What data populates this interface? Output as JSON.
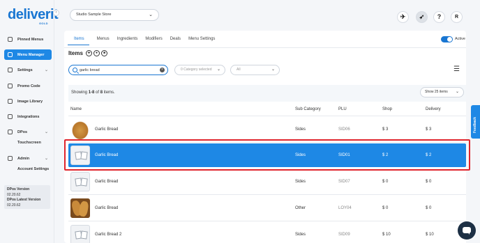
{
  "brand": {
    "name": "deliverit",
    "sub": "GOLD"
  },
  "sidebar": {
    "items": [
      {
        "label": "Pinned Menus"
      },
      {
        "label": "Menu Manager",
        "active": true
      },
      {
        "label": "Settings"
      },
      {
        "label": "Promo Code"
      },
      {
        "label": "Image Library"
      },
      {
        "label": "Integrations"
      },
      {
        "label": "DPos"
      },
      {
        "label": "Admin"
      }
    ],
    "sub_items": {
      "dpos": "Touchscreen",
      "admin": "Account Settings"
    },
    "version": {
      "label": "DPos Version",
      "value": "02.20.62",
      "latest_label": "DPos Latest Version",
      "latest_value": "02.20.62"
    }
  },
  "header": {
    "store": "Studio Sample Store",
    "avatar_initial": "R",
    "help": "?"
  },
  "tabs": [
    {
      "label": "Items",
      "active": true
    },
    {
      "label": "Menus"
    },
    {
      "label": "Ingredients"
    },
    {
      "label": "Modifiers"
    },
    {
      "label": "Deals"
    },
    {
      "label": "Menu Settings"
    }
  ],
  "active_toggle": {
    "label": "Active",
    "on": true
  },
  "items_section": {
    "title": "Items",
    "search_value": "garlic bread",
    "category_placeholder": "0 Category selected",
    "filter_all": "All",
    "showing_prefix": "Showing ",
    "showing_range": "1-8",
    "showing_of": " of ",
    "showing_total": "8",
    "showing_suffix": " items.",
    "page_size": "Show 25 items"
  },
  "table": {
    "headers": {
      "name": "Name",
      "sub_category": "Sub Category",
      "plu": "PLU",
      "shop": "Shop",
      "delivery": "Delivery"
    },
    "rows": [
      {
        "name": "Garlic Bread",
        "sub_category": "Sides",
        "plu": "SID06",
        "shop": "$ 3",
        "delivery": "$ 3",
        "thumb": "bread1"
      },
      {
        "name": "Garlic Bread",
        "sub_category": "Sides",
        "plu": "SID01",
        "shop": "$ 2",
        "delivery": "$ 2",
        "thumb": "placeholder",
        "selected": true
      },
      {
        "name": "Garlic Bread",
        "sub_category": "Sides",
        "plu": "SID07",
        "shop": "$ 0",
        "delivery": "$ 0",
        "thumb": "placeholder"
      },
      {
        "name": "Garlic Bread",
        "sub_category": "Other",
        "plu": "LOY04",
        "shop": "$ 0",
        "delivery": "$ 0",
        "thumb": "bread2"
      },
      {
        "name": "Garlic Bread 2",
        "sub_category": "Sides",
        "plu": "SID09",
        "shop": "$ 10",
        "delivery": "$ 10",
        "thumb": "placeholder"
      }
    ]
  },
  "feedback": {
    "label": "Feedback"
  },
  "colors": {
    "accent": "#1e88e5",
    "highlight": "#e0242c",
    "chat": "#1c2f44"
  }
}
